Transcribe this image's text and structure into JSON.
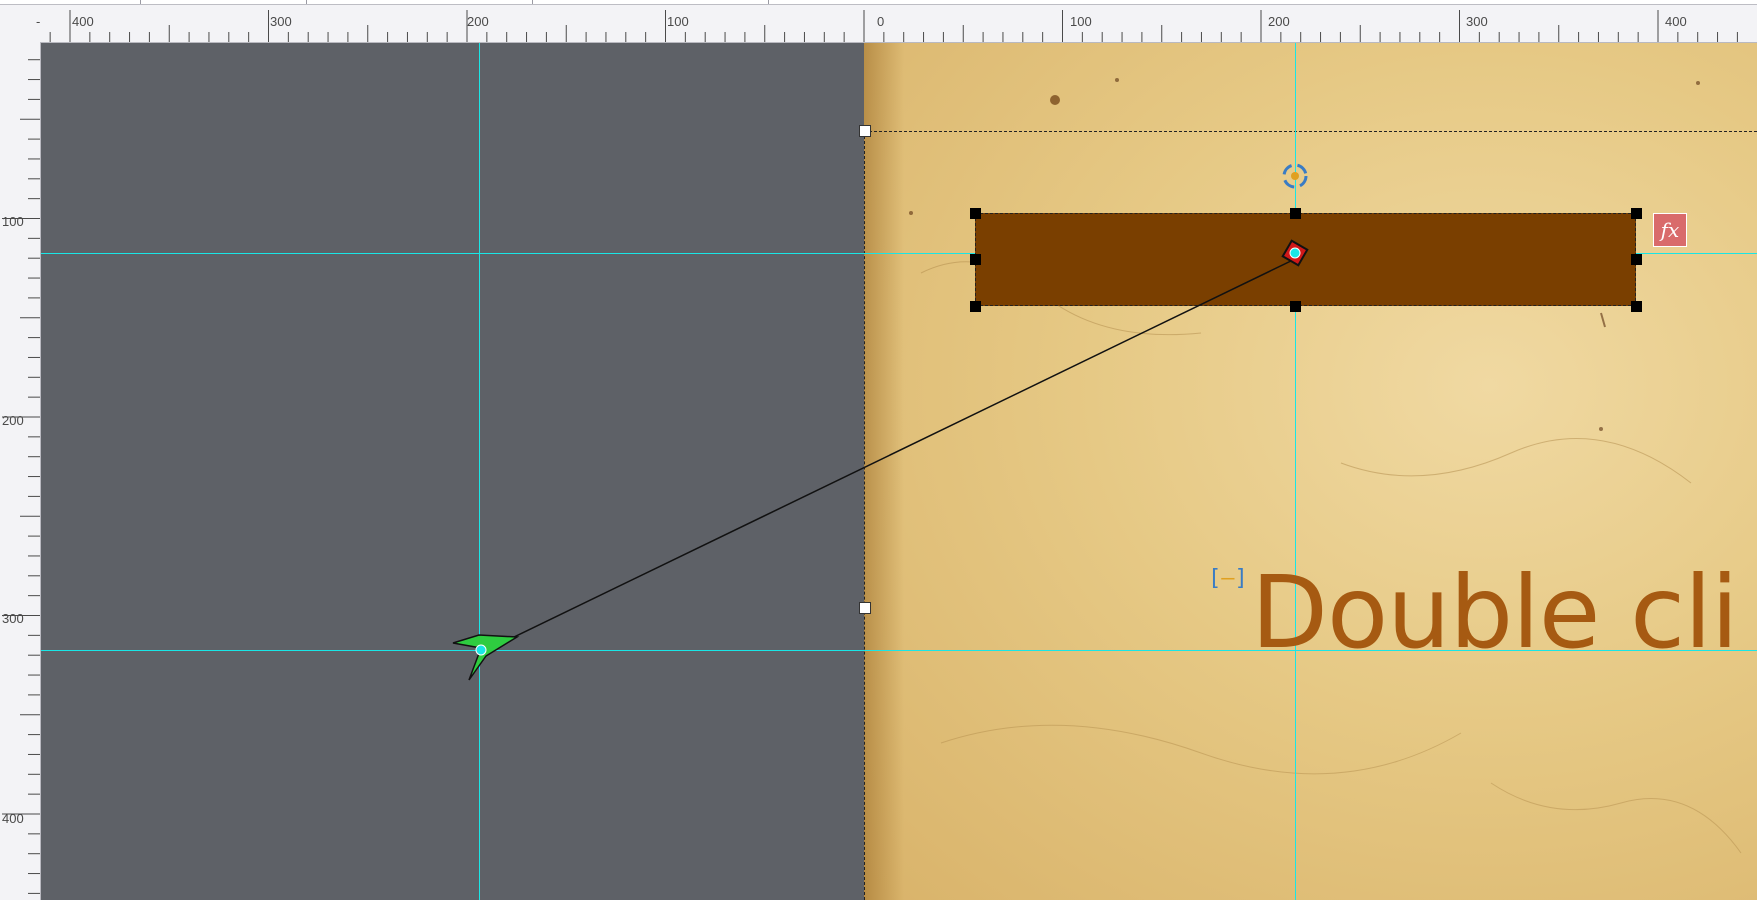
{
  "ruler_h": {
    "labels": [
      "400",
      "300",
      "200",
      "100",
      "0",
      "100",
      "200",
      "300",
      "400"
    ],
    "minus": "-"
  },
  "ruler_v": {
    "labels": [
      "100",
      "200",
      "300",
      "400"
    ]
  },
  "canvas": {
    "pasteboard_color": "#5e6167",
    "guide_color": "#19e6e6",
    "selected_fill_color": "#7a3f00"
  },
  "text_frame": {
    "content": "Double cli",
    "bracket_open": "[",
    "bracket_dash": "–",
    "bracket_close": "]",
    "color": "#a65a12"
  },
  "fx_badge": {
    "label": "fx"
  }
}
